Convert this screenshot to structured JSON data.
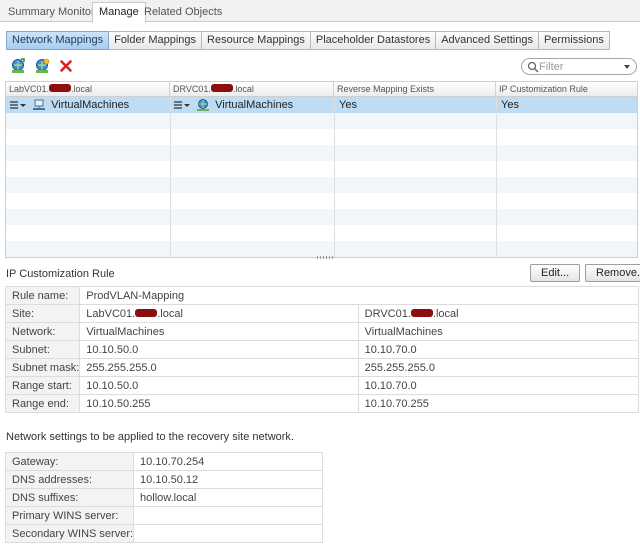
{
  "top_tabs": [
    {
      "label": "Summary"
    },
    {
      "label": "Monitor"
    },
    {
      "label": "Manage",
      "active": true
    },
    {
      "label": "Related Objects"
    }
  ],
  "sub_tabs": [
    {
      "label": "Network Mappings",
      "active": true
    },
    {
      "label": "Folder Mappings"
    },
    {
      "label": "Resource Mappings"
    },
    {
      "label": "Placeholder Datastores"
    },
    {
      "label": "Advanced Settings"
    },
    {
      "label": "Permissions"
    }
  ],
  "toolbar": {
    "icons": [
      "add-mapping-icon",
      "add-mapping-wizard-icon",
      "delete-icon"
    ]
  },
  "filter": {
    "placeholder": "Filter"
  },
  "grid": {
    "columns": [
      {
        "prefix": "LabVC01.",
        "suffix": ".local"
      },
      {
        "prefix": "DRVC01.",
        "suffix": ".local"
      },
      {
        "label": "Reverse Mapping Exists"
      },
      {
        "label": "IP Customization Rule"
      }
    ],
    "rows": [
      {
        "source": "VirtualMachines",
        "target": "VirtualMachines",
        "reverse": "Yes",
        "ip_rule": "Yes"
      }
    ]
  },
  "details": {
    "title": "IP Customization Rule",
    "edit_label": "Edit...",
    "remove_label": "Remove...",
    "rule_name_label": "Rule name:",
    "rule_name_value": "ProdVLAN-Mapping",
    "site_label": "Site:",
    "site_source_prefix": "LabVC01.",
    "site_source_suffix": ".local",
    "site_target_prefix": "DRVC01.",
    "site_target_suffix": ".local",
    "rows": [
      {
        "label": "Network:",
        "source": "VirtualMachines",
        "target": "VirtualMachines"
      },
      {
        "label": "Subnet:",
        "source": "10.10.50.0",
        "target": "10.10.70.0"
      },
      {
        "label": "Subnet mask:",
        "source": "255.255.255.0",
        "target": "255.255.255.0"
      },
      {
        "label": "Range start:",
        "source": "10.10.50.0",
        "target": "10.10.70.0"
      },
      {
        "label": "Range end:",
        "source": "10.10.50.255",
        "target": "10.10.70.255"
      }
    ]
  },
  "network_note": "Network settings to be applied to the recovery site network.",
  "network_settings": [
    {
      "label": "Gateway:",
      "value": "10.10.70.254"
    },
    {
      "label": "DNS addresses:",
      "value": "10.10.50.12"
    },
    {
      "label": "DNS suffixes:",
      "value": "hollow.local"
    },
    {
      "label": "Primary WINS server:",
      "value": ""
    },
    {
      "label": "Secondary WINS server:",
      "value": ""
    }
  ],
  "colors": {
    "selected_row": "#bedcf4",
    "alt_row": "#f1f6fb",
    "active_subtab": "#a9cdf0",
    "redaction": "#8b0f0f"
  }
}
